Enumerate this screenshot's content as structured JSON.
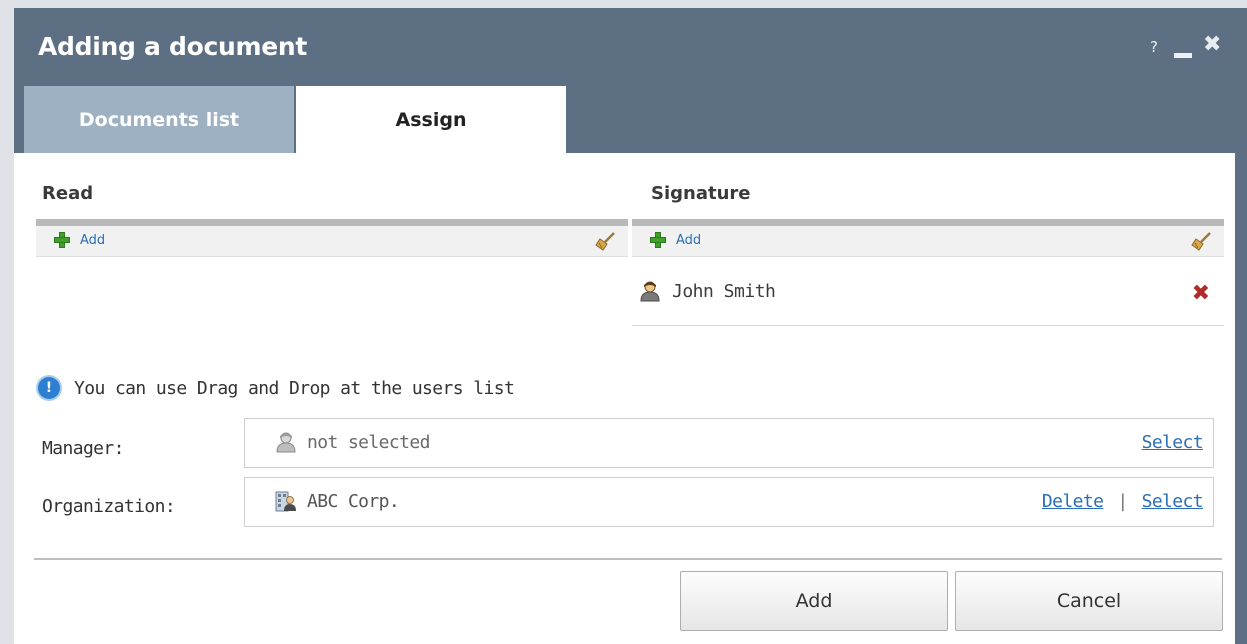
{
  "dialog": {
    "title": "Adding a document",
    "controls": {
      "help": "?",
      "close": "✖"
    }
  },
  "tabs": [
    {
      "label": "Documents list",
      "active": false
    },
    {
      "label": "Assign",
      "active": true
    }
  ],
  "read_panel": {
    "title": "Read",
    "add_label": "Add",
    "users": []
  },
  "signature_panel": {
    "title": "Signature",
    "add_label": "Add",
    "users": [
      {
        "name": "John Smith"
      }
    ]
  },
  "hint": {
    "text": "You can use Drag and Drop at the users list"
  },
  "manager": {
    "label": "Manager:",
    "value": "not selected",
    "select_label": "Select"
  },
  "organization": {
    "label": "Organization:",
    "value": "ABC Corp.",
    "delete_label": "Delete",
    "separator": "|",
    "select_label": "Select"
  },
  "buttons": {
    "add": "Add",
    "cancel": "Cancel"
  },
  "colors": {
    "titlebar": "#5d6f82",
    "inactive_tab": "#9eb1c3",
    "link": "#2a6fb5",
    "add_icon": "#3fa12b",
    "remove_icon": "#b22b2b",
    "info_icon": "#2f7fd0"
  },
  "icons": {
    "add": "plus-icon",
    "clear": "broom-icon",
    "user": "user-icon",
    "remove": "close-icon",
    "info": "info-icon",
    "organization": "building-user-icon"
  }
}
